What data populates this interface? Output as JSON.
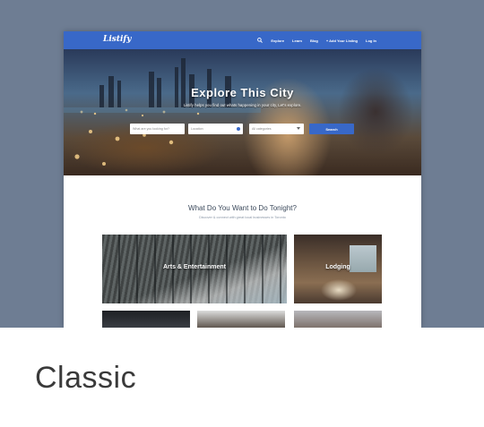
{
  "site": {
    "logo": "Listify",
    "nav": [
      "Explore",
      "Learn",
      "Blog",
      "+ Add Your Listing",
      "Log In"
    ]
  },
  "hero": {
    "title": "Explore This City",
    "subtitle": "Listify helps you find out whats happening in your city, Let's explore.",
    "keyword_placeholder": "What are you looking for?",
    "location_placeholder": "Location",
    "category_placeholder": "All categories",
    "search_label": "Search"
  },
  "section": {
    "title": "What Do You Want to Do Tonight?",
    "subtitle": "Discover & connect with great local businesses in Toronto"
  },
  "tiles": [
    "Arts & Entertainment",
    "Lodging"
  ],
  "caption": "Classic",
  "colors": {
    "brand": "#3868c8",
    "backdrop": "#6e7d93"
  }
}
